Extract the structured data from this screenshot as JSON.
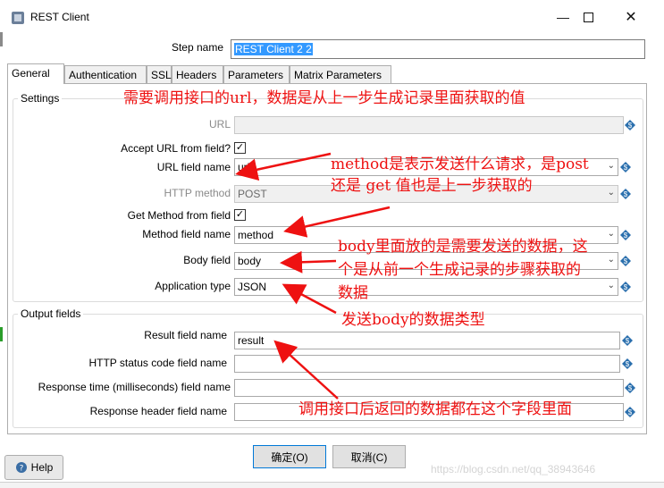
{
  "window": {
    "title": "REST Client"
  },
  "step": {
    "label": "Step name",
    "value": "REST Client 2 2"
  },
  "tabs": [
    "General",
    "Authentication",
    "SSL",
    "Headers",
    "Parameters",
    "Matrix Parameters"
  ],
  "settings": {
    "title": "Settings",
    "url_label": "URL",
    "url_value": "",
    "accept_url_label": "Accept URL from field?",
    "url_field_label": "URL field name",
    "url_field_value": "url",
    "http_method_label": "HTTP method",
    "http_method_value": "POST",
    "get_method_label": "Get Method from field",
    "method_field_label": "Method field name",
    "method_field_value": "method",
    "body_field_label": "Body field",
    "body_field_value": "body",
    "app_type_label": "Application type",
    "app_type_value": "JSON"
  },
  "output": {
    "title": "Output fields",
    "result_label": "Result field name",
    "result_value": "result",
    "status_label": "HTTP status code field name",
    "status_value": "",
    "response_time_label": "Response time (milliseconds) field name",
    "response_time_value": "",
    "response_header_label": "Response header field name",
    "response_header_value": ""
  },
  "buttons": {
    "ok": "确定(O)",
    "cancel": "取消(C)",
    "help": "Help"
  },
  "annotations": {
    "a1": "需要调用接口的url，数据是从上一步生成记录里面获取的值",
    "a2_line1": "method是表示发送什么请求，是post",
    "a2_line2": "还是 get 值也是上一步获取的",
    "a3_line1": "body里面放的是需要发送的数据，这",
    "a3_line2": "个是从前一个生成记录的步骤获取的",
    "a3_line3": "数据",
    "a4": "发送body的数据类型",
    "a5": "调用接口后返回的数据都在这个字段里面"
  },
  "watermark": "https://blog.csdn.net/qq_38943646",
  "colors": {
    "annotation": "#ee1111",
    "selection": "#3399ff",
    "accent": "#0078d7",
    "var_icon": "#2a6fad"
  },
  "icons": [
    "app-icon",
    "minimize-icon",
    "maximize-icon",
    "close-icon",
    "checkbox-checked-icon",
    "dropdown-arrow-icon",
    "variable-diamond-icon",
    "help-icon"
  ]
}
